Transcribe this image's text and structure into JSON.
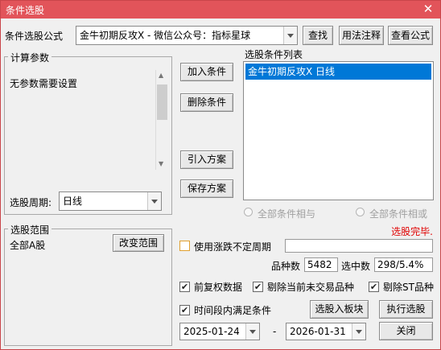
{
  "window": {
    "title": "条件选股",
    "close_glyph": "✕"
  },
  "formula": {
    "label": "条件选股公式",
    "selected": "金牛初期反攻X  -  微信公众号：指标星球"
  },
  "buttons": {
    "find": "查找",
    "usage": "用法注释",
    "view_formula": "查看公式",
    "add_condition": "加入条件",
    "remove_condition": "删除条件",
    "import_plan": "引入方案",
    "save_plan": "保存方案",
    "change_scope": "改变范围",
    "select_into_sector": "选股入板块",
    "execute": "执行选股",
    "close": "关闭"
  },
  "params": {
    "group_title": "计算参数",
    "text": "无参数需要设置",
    "period_label": "选股周期:",
    "period_value": "日线"
  },
  "condition_list": {
    "title": "选股条件列表",
    "items": [
      "金牛初期反攻X  日线"
    ]
  },
  "logic": {
    "and_label": "全部条件相与",
    "or_label": "全部条件相或"
  },
  "status": {
    "text": "选股完毕.",
    "color": "#e00000"
  },
  "scope": {
    "group_title": "选股范围",
    "value": "全部A股"
  },
  "options": {
    "variable_period": {
      "label": "使用涨跌不定周期",
      "checked": false,
      "input_value": ""
    },
    "stock_count_label": "品种数",
    "stock_count": "5482",
    "selected_label": "选中数",
    "selected_value": "298/5.4%",
    "forward_adjusted": {
      "label": "前复权数据",
      "checked": true
    },
    "exclude_non_trading": {
      "label": "剔除当前未交易品种",
      "checked": true
    },
    "exclude_st": {
      "label": "剔除ST品种",
      "checked": true
    },
    "time_range": {
      "label": "时间段内满足条件",
      "checked": true
    }
  },
  "dates": {
    "start": "2025-01-24",
    "separator": "-",
    "end": "2026-01-31"
  }
}
